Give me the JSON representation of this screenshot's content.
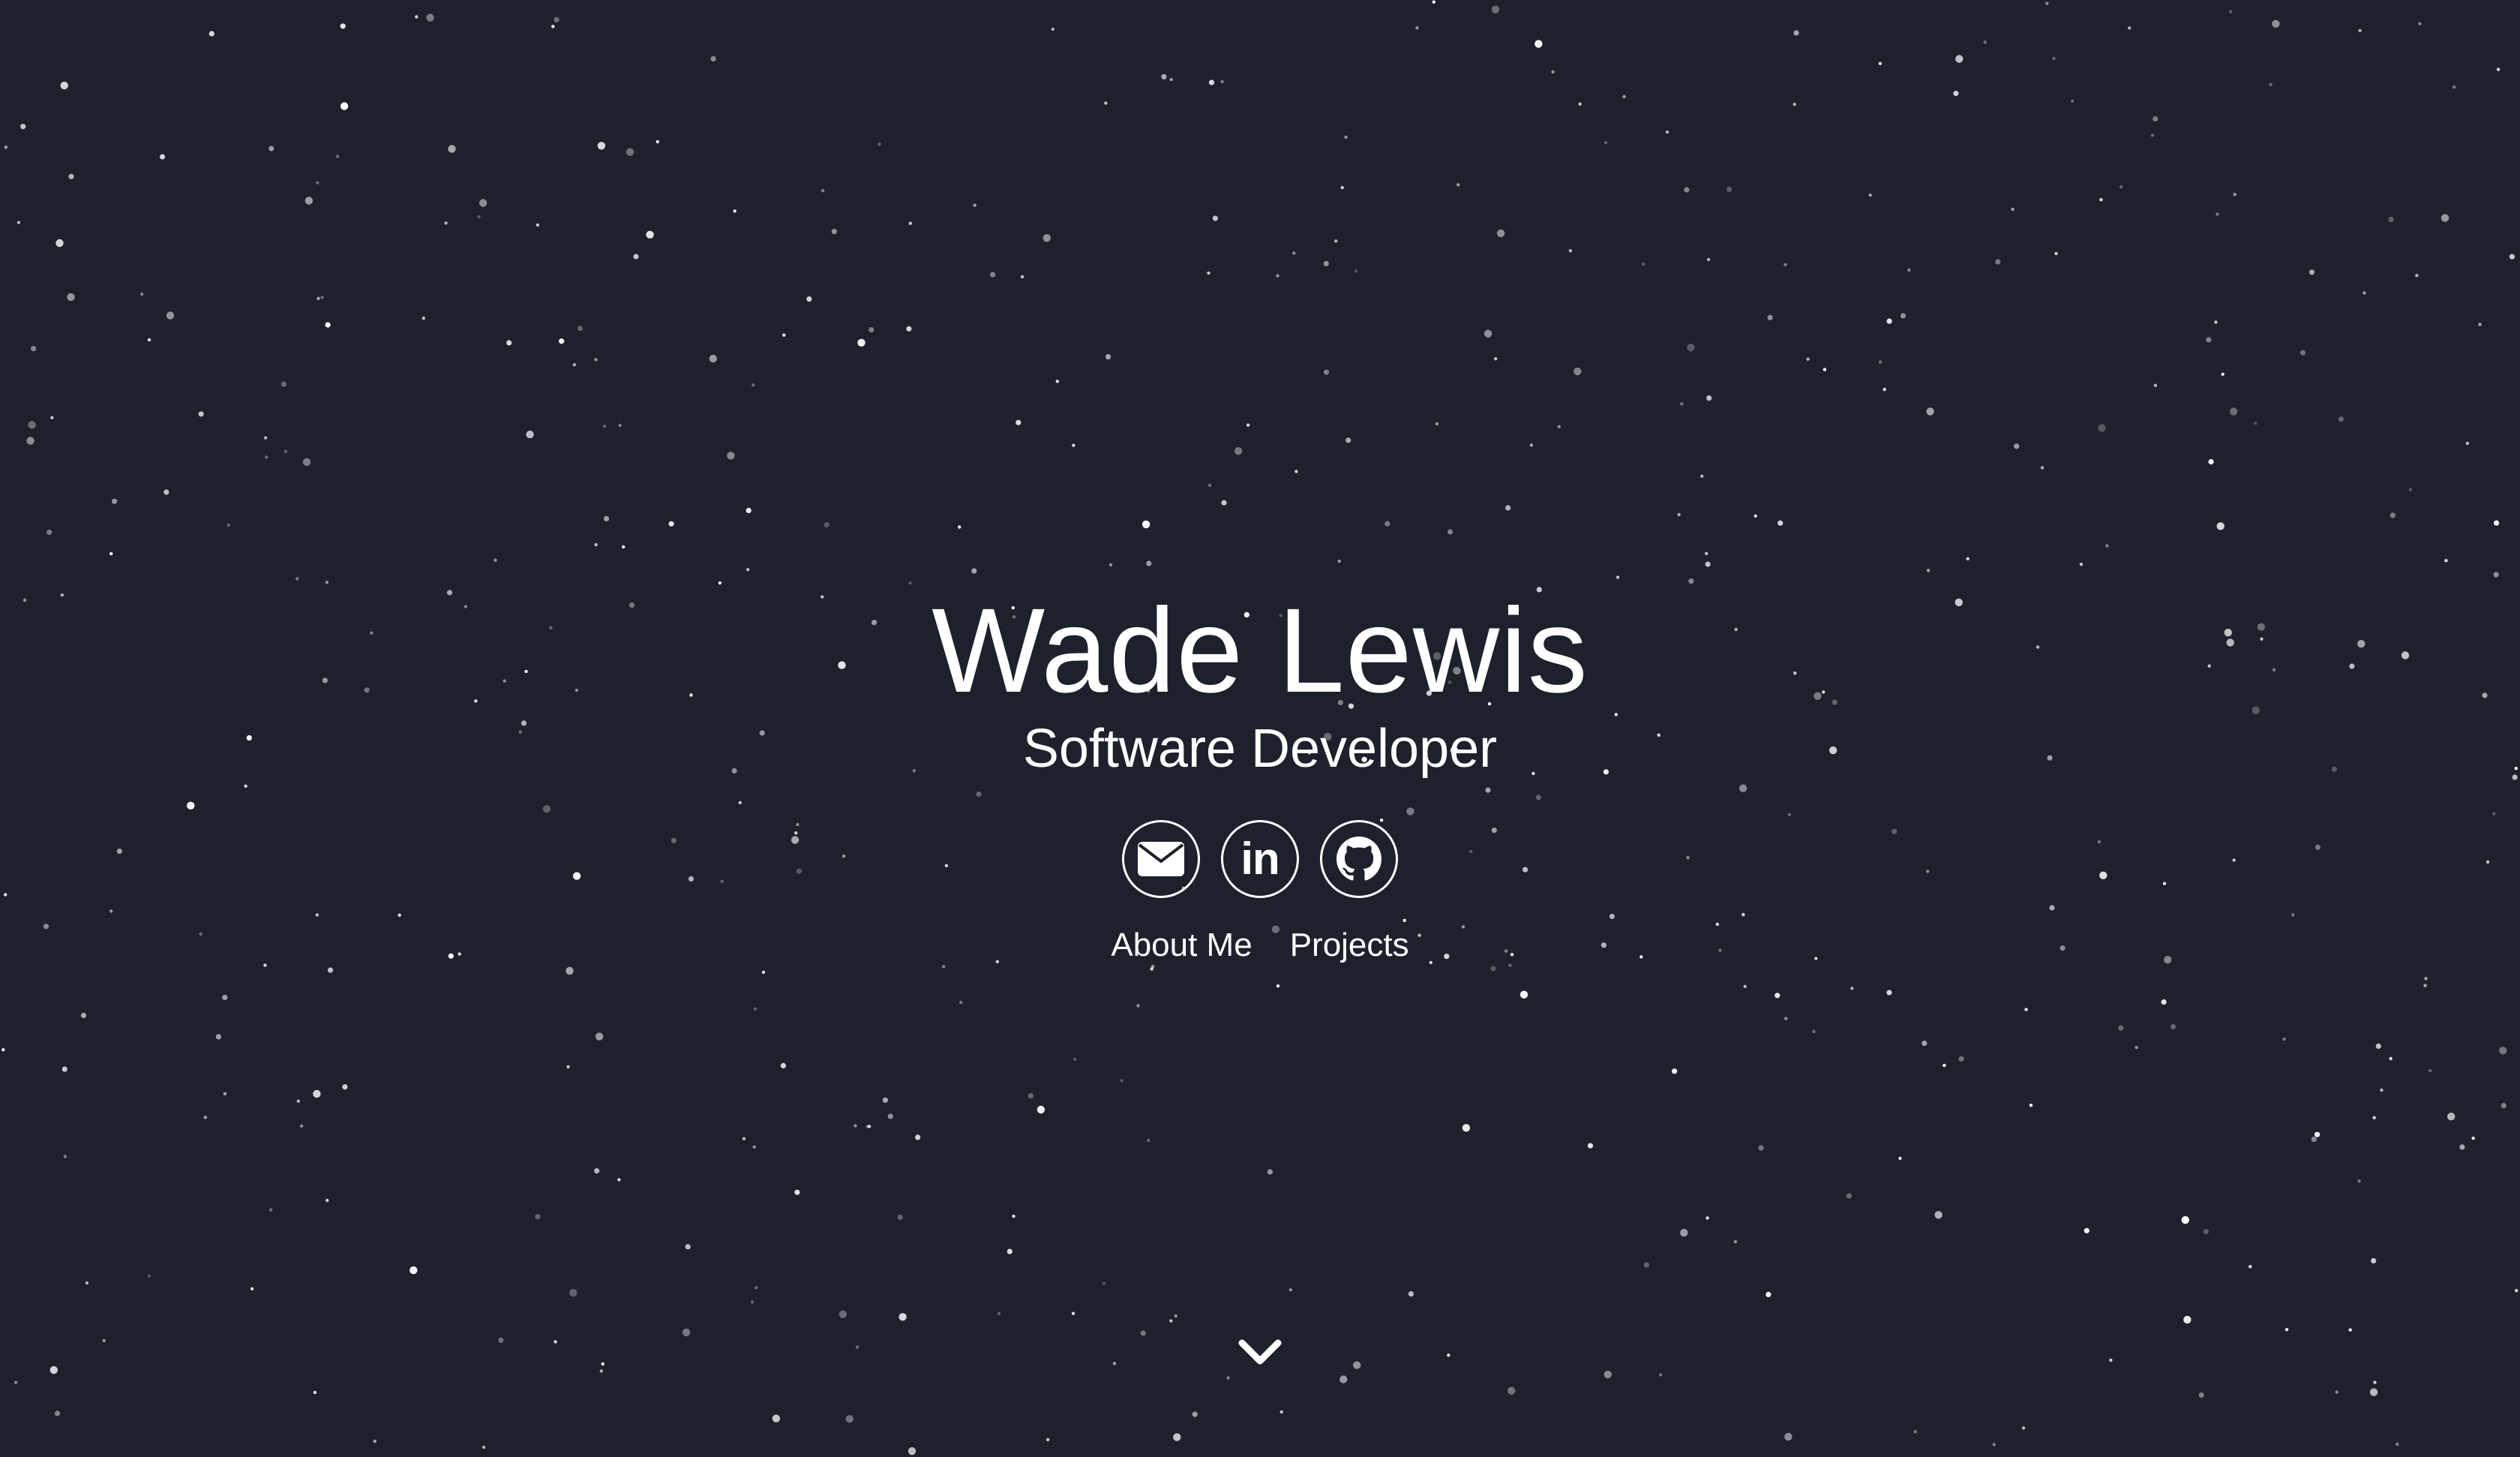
{
  "hero": {
    "name": "Wade Lewis",
    "title": "Software Developer"
  },
  "socials": [
    {
      "name": "email",
      "icon": "envelope-icon"
    },
    {
      "name": "linkedin",
      "icon": "linkedin-icon",
      "glyph": "in"
    },
    {
      "name": "github",
      "icon": "github-icon"
    }
  ],
  "nav": {
    "about_label": "About Me",
    "projects_label": "Projects"
  },
  "scroll": {
    "icon": "chevron-down-icon"
  },
  "colors": {
    "background": "#1c212c",
    "text": "#ffffff",
    "star": "#ffffff"
  }
}
